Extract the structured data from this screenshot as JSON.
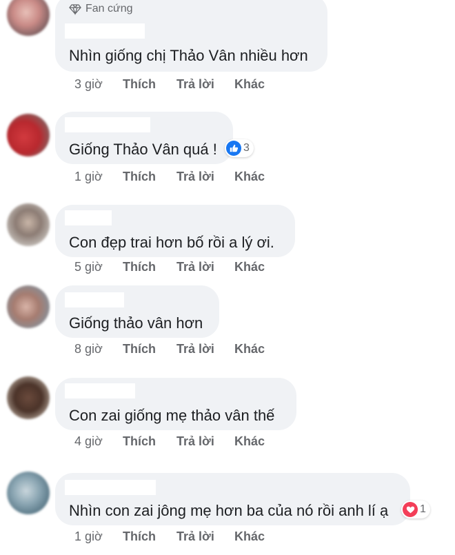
{
  "badge_label": "Fan cứng",
  "actions": {
    "like": "Thích",
    "reply": "Trả lời",
    "more": "Khác"
  },
  "comments": [
    {
      "text": "Nhìn giống chị Thảo Vân nhiều hơn",
      "time": "3 giờ",
      "reactions": ""
    },
    {
      "text": "Giống Thảo Vân quá !",
      "time": "1 giờ",
      "reactions": "3",
      "reaction_icon": "like-icon"
    },
    {
      "text": "Con đẹp trai hơn bố rồi a lý ơi.",
      "time": "5 giờ",
      "reactions": ""
    },
    {
      "text": "Giống thảo vân hơn",
      "time": "8 giờ",
      "reactions": ""
    },
    {
      "text": "Con zai giống mẹ thảo vân thế",
      "time": "4 giờ",
      "reactions": ""
    },
    {
      "text": "Nhìn con zai jông mẹ hơn ba của nó rồi anh lí ạ",
      "time": "1 giờ",
      "reactions": "1",
      "reaction_icon": "heart-icon"
    }
  ],
  "colors": {
    "bubble": "#f0f2f5",
    "like_blue": "#1877f2",
    "heart_red": "#f33e58",
    "meta_gray": "#65676b"
  }
}
